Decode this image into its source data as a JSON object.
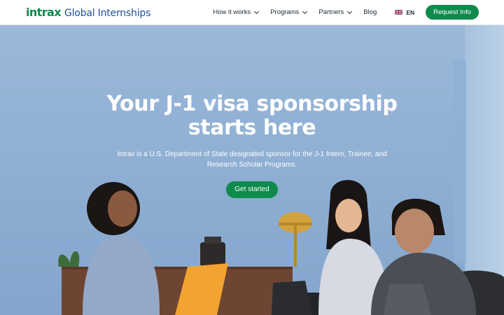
{
  "header": {
    "logo_word": "intrax",
    "logo_sub": "Global Internships",
    "nav": [
      {
        "label": "How it works",
        "has_dropdown": true
      },
      {
        "label": "Programs",
        "has_dropdown": true
      },
      {
        "label": "Partners",
        "has_dropdown": true
      },
      {
        "label": "Blog",
        "has_dropdown": false
      }
    ],
    "language": "EN",
    "request_button": "Request Info"
  },
  "hero": {
    "title_line1": "Your J-1 visa sponsorship",
    "title_line2": "starts here",
    "subtitle": "Intrax is a U.S. Department of State designated sponsor for the J-1 Intern, Trainee, and Research Scholar Programs.",
    "cta": "Get started"
  },
  "colors": {
    "brand_green": "#0e8a4b",
    "brand_blue": "#1c4f9c",
    "hero_wall": "#8fb0d4"
  },
  "icons": [
    "chevron-down-icon",
    "uk-flag-icon"
  ]
}
